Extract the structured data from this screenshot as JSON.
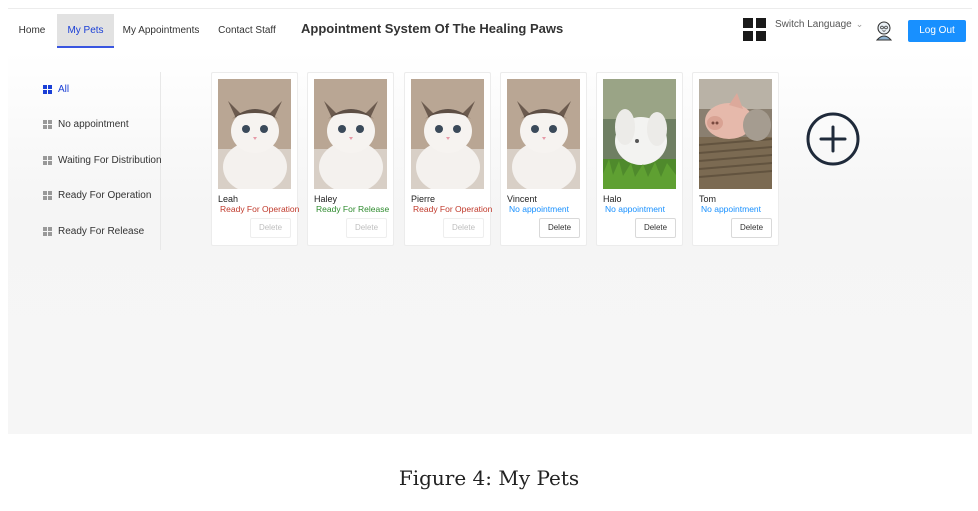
{
  "nav": {
    "home": "Home",
    "my_pets": "My Pets",
    "my_appointments": "My Appointments",
    "contact_staff": "Contact Staff"
  },
  "app_title": "Appointment System Of The Healing Paws",
  "header": {
    "switch_language": "Switch Language",
    "logout": "Log Out"
  },
  "sidebar": {
    "items": [
      {
        "label": "All",
        "active": true
      },
      {
        "label": "No appointment",
        "active": false
      },
      {
        "label": "Waiting For Distribution",
        "active": false
      },
      {
        "label": "Ready For Operation",
        "active": false
      },
      {
        "label": "Ready For Release",
        "active": false
      }
    ]
  },
  "pets": [
    {
      "name": "Leah",
      "status": "Ready For Operation",
      "status_color": "#c0392b",
      "delete": "Delete",
      "delete_enabled": false,
      "photo": "cat-icon"
    },
    {
      "name": "Haley",
      "status": "Ready For Release",
      "status_color": "#2e8b2e",
      "delete": "Delete",
      "delete_enabled": false,
      "photo": "cat-icon"
    },
    {
      "name": "Pierre",
      "status": "Ready For Operation",
      "status_color": "#c0392b",
      "delete": "Delete",
      "delete_enabled": false,
      "photo": "cat-icon"
    },
    {
      "name": "Vincent",
      "status": "No appointment",
      "status_color": "#1890ff",
      "delete": "Delete",
      "delete_enabled": true,
      "photo": "cat-icon"
    },
    {
      "name": "Halo",
      "status": "No appointment",
      "status_color": "#1890ff",
      "delete": "Delete",
      "delete_enabled": true,
      "photo": "rabbit-icon"
    },
    {
      "name": "Tom",
      "status": "No appointment",
      "status_color": "#1890ff",
      "delete": "Delete",
      "delete_enabled": true,
      "photo": "pig-icon"
    }
  ],
  "add_pet_icon": "plus-circle-icon",
  "caption": "Figure 4: My Pets"
}
